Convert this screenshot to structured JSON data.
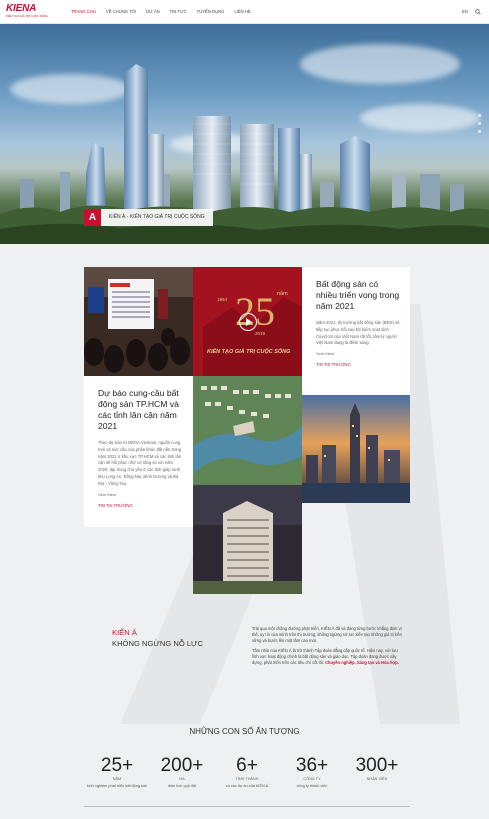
{
  "header": {
    "logo": "KIENA",
    "logo_tagline": "KIẾN TẠO GIÁ TRỊ CUỘC SỐNG",
    "nav": [
      "TRANG CHỦ",
      "VỀ CHÚNG TÔI",
      "DỰ ÁN",
      "TIN TỨC",
      "TUYỂN DỤNG",
      "LIÊN HỆ"
    ],
    "lang": "EN"
  },
  "hero": {
    "caption": "KIẾN Á - KIẾN TẠO GIÁ TRỊ CUỘC SỐNG"
  },
  "cards": {
    "card1": {
      "title": "Bất động sản có nhiều triển vọng trong năm 2021",
      "desc": "Năm 2021, thị trường bất động sản (BĐS) sẽ tiếp tục phục hồi sau khi kiểm soát dịch Covid-19 của Việt Nam rất tốt, tâm lý người Việt Nam đang là điểm sáng.",
      "more": "Xem thêm",
      "category": "TIN THỊ TRƯỜNG"
    },
    "card2": {
      "title": "Dự báo cung-cầu bất động sản TP.HCM và các tỉnh lân cận năm 2021",
      "desc": "Theo dự báo từ DKRA Vietnam, nguồn cung mới và sức cầu của phân khúc đất nền trong năm 2021 ở khu vực TP.HCM và các tỉnh lân cận sẽ hồi phục nhờ cơ tăng so với năm 2020, tập trung chủ yếu ở các tỉnh giáp ranh khu Long An, Đồng Nai, Bình Dương và Bà Rịa - Vũng Tàu.",
      "more": "Xem thêm",
      "category": "TIN THỊ TRƯỜNG"
    }
  },
  "anniversary": {
    "year_start": "1994",
    "year_end": "2019",
    "number": "25",
    "unit": "năm",
    "slogan": "KIẾN TẠO GIÁ TRỊ CUỘC SỐNG"
  },
  "intro": {
    "brand": "KIẾN Á",
    "slogan": "KHÔNG NGỪNG NỖ LỰC",
    "para1": "Trải qua một chặng đường phát triển, KIẾN Á đã và đang từng bước khẳng định vị thế, uy tín của mình trên thị trường, không ngừng sở lực kiến tạo những giá trị bền vững và bước lên một tầm cao mới.",
    "para2": "Tầm nhìn của KIẾN Á là trở thành Tập đoàn đẳng cấp quốc tế. Hiện nay, với lưu lĩnh vực hoạt động chính là bất động sản và giáo dục, Tập đoàn đang được xây dựng, phát triển trên các tiêu chí cốt lõi: ",
    "core_values": "Chuyên nghiệp, Sáng tạo và Hòa hợp."
  },
  "stats": {
    "title": "NHỮNG CON SỐ ẤN TƯỢNG",
    "items": [
      {
        "number": "25+",
        "unit": "NĂM",
        "desc": "kinh nghiệm phát triển bất động sản"
      },
      {
        "number": "200+",
        "unit": "HA",
        "desc": "diện tích quỹ đất"
      },
      {
        "number": "6+",
        "unit": "TÌNH THÀNH",
        "desc": "có các dự án của KIẾN Á"
      },
      {
        "number": "36+",
        "unit": "CÔNG TY",
        "desc": "công ty thành viên"
      },
      {
        "number": "300+",
        "unit": "NHÂN VIÊN",
        "desc": ""
      }
    ]
  },
  "colors": {
    "brand_red": "#c8102e",
    "background": "#eef0f1"
  },
  "icons": [
    "search-icon",
    "play-icon"
  ]
}
